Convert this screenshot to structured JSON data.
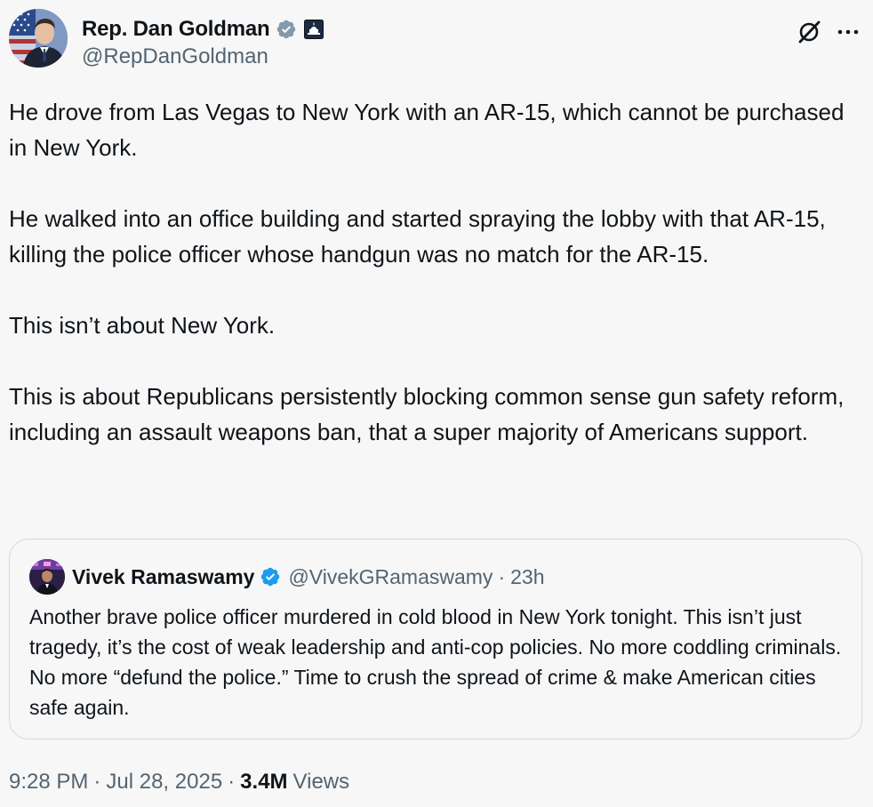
{
  "author": {
    "display_name": "Rep. Dan Goldman",
    "handle": "@RepDanGoldman",
    "verified_icon": "verified-badge-gray-icon",
    "affiliation_icon": "us-capitol-icon"
  },
  "actions": {
    "grok_icon": "grok-icon",
    "more_icon": "more-icon"
  },
  "body": {
    "paragraphs": [
      "He drove from Las Vegas to New York with an AR-15, which cannot be purchased in New York.",
      "He walked into an office building and started spraying the lobby with that AR-15, killing the police officer whose handgun was no match for the AR-15.",
      "This isn’t about New York.",
      "This is about Republicans persistently blocking common sense gun safety reform, including an assault weapons ban, that a super majority of Americans support."
    ]
  },
  "quote": {
    "display_name": "Vivek Ramaswamy",
    "handle": "@VivekGRamaswamy",
    "separator": "·",
    "time": "23h",
    "verified_icon": "verified-badge-blue-icon",
    "text": "Another brave police officer murdered in cold blood in New York tonight. This isn’t just tragedy, it’s the cost of weak leadership and anti-cop policies. No more coddling criminals. No more “defund the police.” Time to crush the spread of crime & make American cities safe again."
  },
  "meta": {
    "time": "9:28 PM",
    "separator": "·",
    "date": "Jul 28, 2025",
    "views_count": "3.4M",
    "views_label": "Views"
  },
  "colors": {
    "background": "#f7f7f7",
    "text": "#0f1419",
    "secondary_text": "#536471",
    "verified_blue": "#1d9bf0",
    "verified_gray": "#829aab",
    "border": "#cfd9de"
  }
}
